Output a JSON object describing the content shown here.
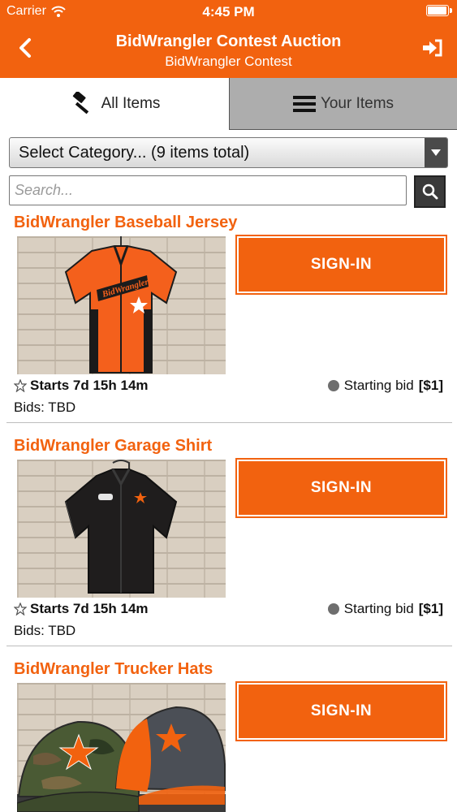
{
  "status_bar": {
    "carrier": "Carrier",
    "time": "4:45 PM",
    "battery_level": 0.9
  },
  "nav": {
    "title": "BidWrangler Contest Auction",
    "subtitle": "BidWrangler Contest",
    "back_icon": "chevron-left-icon",
    "signout_icon": "sign-in-arrow-icon"
  },
  "tabs": [
    {
      "label": "All Items",
      "icon": "gavel-icon",
      "active": true
    },
    {
      "label": "Your Items",
      "icon": "hamburger-icon",
      "active": false
    }
  ],
  "category_select": {
    "value": "Select Category... (9 items total)"
  },
  "search": {
    "placeholder": "Search..."
  },
  "colors": {
    "accent": "#f2620f",
    "tab_inactive": "#adadad",
    "search_button": "#3a3a3a"
  },
  "items": [
    {
      "title": "BidWrangler Baseball Jersey",
      "button": "SIGN-IN",
      "starts": "Starts 7d 15h 14m",
      "bid_label": "Starting bid",
      "bid_amount": "[$1]",
      "bids": "Bids: TBD",
      "image": "orange-baseball-jersey"
    },
    {
      "title": "BidWrangler Garage Shirt",
      "button": "SIGN-IN",
      "starts": "Starts 7d 15h 14m",
      "bid_label": "Starting bid",
      "bid_amount": "[$1]",
      "bids": "Bids: TBD",
      "image": "black-garage-shirt"
    },
    {
      "title": "BidWrangler Trucker Hats",
      "button": "SIGN-IN",
      "image": "trucker-hats"
    }
  ]
}
